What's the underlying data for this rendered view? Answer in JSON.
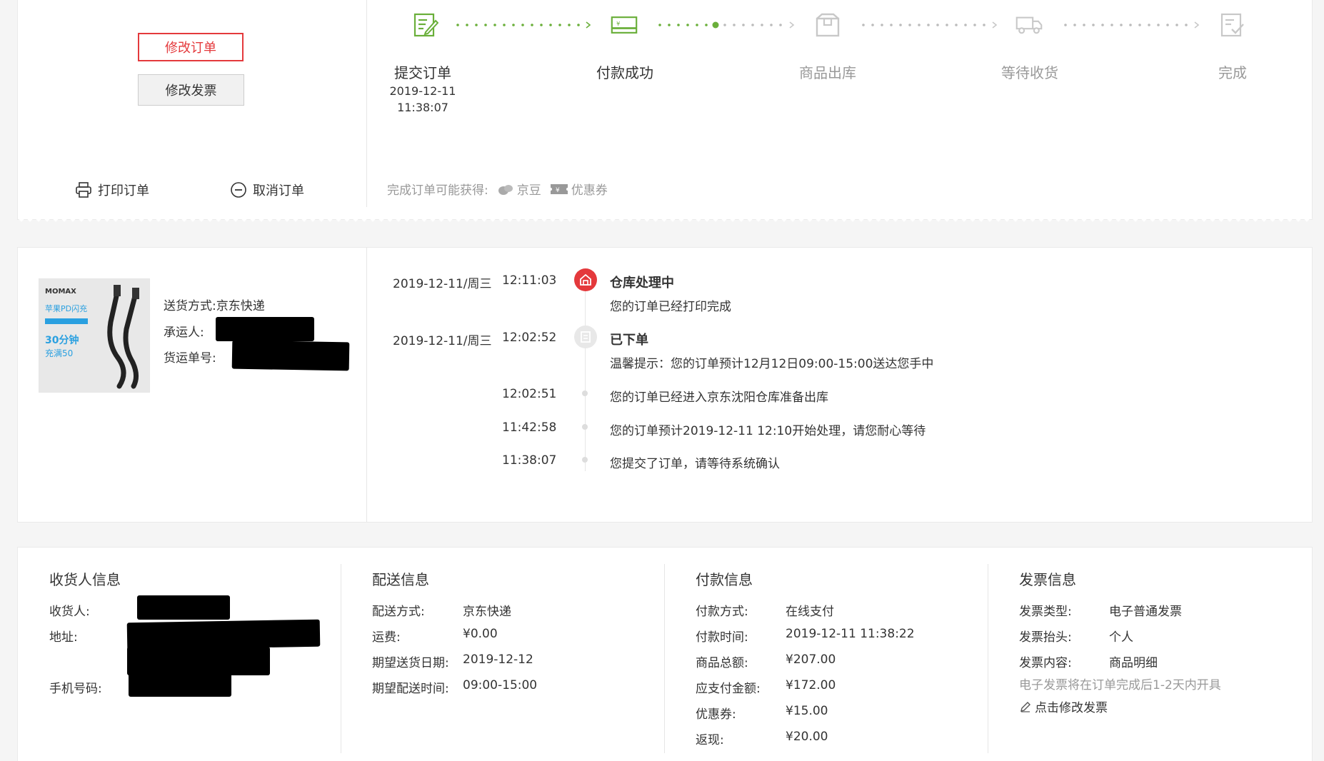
{
  "actions": {
    "modify_order": "修改订单",
    "modify_invoice": "修改发票",
    "print_order": "打印订单",
    "cancel_order": "取消订单"
  },
  "steps": [
    {
      "name": "提交订单",
      "state": "done",
      "icon": "edit-form-icon"
    },
    {
      "name": "付款成功",
      "state": "done",
      "icon": "payment-card-icon"
    },
    {
      "name": "商品出库",
      "state": "todo",
      "icon": "box-icon"
    },
    {
      "name": "等待收货",
      "state": "todo",
      "icon": "truck-icon"
    },
    {
      "name": "完成",
      "state": "todo",
      "icon": "check-doc-icon"
    }
  ],
  "submit_time": {
    "date": "2019-12-11",
    "time": "11:38:07"
  },
  "perks": {
    "label": "完成订单可能获得:",
    "items": [
      "京豆",
      "优惠券"
    ]
  },
  "shipment": {
    "method_label": "送货方式:",
    "method_value": "京东快递",
    "carrier_label": "承运人:",
    "tracking_label": "货运单号:",
    "product_image_texts": [
      "MOMAX",
      "苹果PD闪充",
      "30分钟",
      "充满50"
    ]
  },
  "timeline": [
    {
      "date": "2019-12-11/周三",
      "time": "12:11:03",
      "title": "仓库处理中",
      "text": "您的订单已经打印完成",
      "badge": "warehouse-icon"
    },
    {
      "date": "2019-12-11/周三",
      "time": "12:02:52",
      "title": "已下单",
      "text": "温馨提示：您的订单预计12月12日09:00-15:00送达您手中",
      "badge": "order-icon"
    },
    {
      "date": "",
      "time": "12:02:51",
      "title": "",
      "text": "您的订单已经进入京东沈阳仓库准备出库"
    },
    {
      "date": "",
      "time": "11:42:58",
      "title": "",
      "text": "您的订单预计2019-12-11 12:10开始处理，请您耐心等待"
    },
    {
      "date": "",
      "time": "11:38:07",
      "title": "",
      "text": "您提交了订单，请等待系统确认"
    }
  ],
  "receiver": {
    "title": "收货人信息",
    "name_label": "收货人:",
    "address_label": "地址:",
    "phone_label": "手机号码:"
  },
  "delivery": {
    "title": "配送信息",
    "rows": [
      {
        "k": "配送方式:",
        "v": "京东快递"
      },
      {
        "k": "运费:",
        "v": "¥0.00"
      },
      {
        "k": "期望送货日期:",
        "v": "2019-12-12"
      },
      {
        "k": "期望配送时间:",
        "v": "09:00-15:00"
      }
    ]
  },
  "payment": {
    "title": "付款信息",
    "rows": [
      {
        "k": "付款方式:",
        "v": "在线支付"
      },
      {
        "k": "付款时间:",
        "v": "2019-12-11 11:38:22"
      },
      {
        "k": "商品总额:",
        "v": "¥207.00"
      },
      {
        "k": "应支付金额:",
        "v": "¥172.00"
      },
      {
        "k": "优惠券:",
        "v": "¥15.00"
      },
      {
        "k": "返现:",
        "v": "¥20.00"
      }
    ]
  },
  "invoice": {
    "title": "发票信息",
    "rows": [
      {
        "k": "发票类型:",
        "v": "电子普通发票"
      },
      {
        "k": "发票抬头:",
        "v": "个人"
      },
      {
        "k": "发票内容:",
        "v": "商品明细"
      }
    ],
    "hint": "电子发票将在订单完成后1-2天内开具",
    "edit_link": "点击修改发票"
  },
  "colors": {
    "accent_red": "#e4393c",
    "done_green": "#6aaf3a",
    "todo_gray": "#bbbbbb"
  }
}
